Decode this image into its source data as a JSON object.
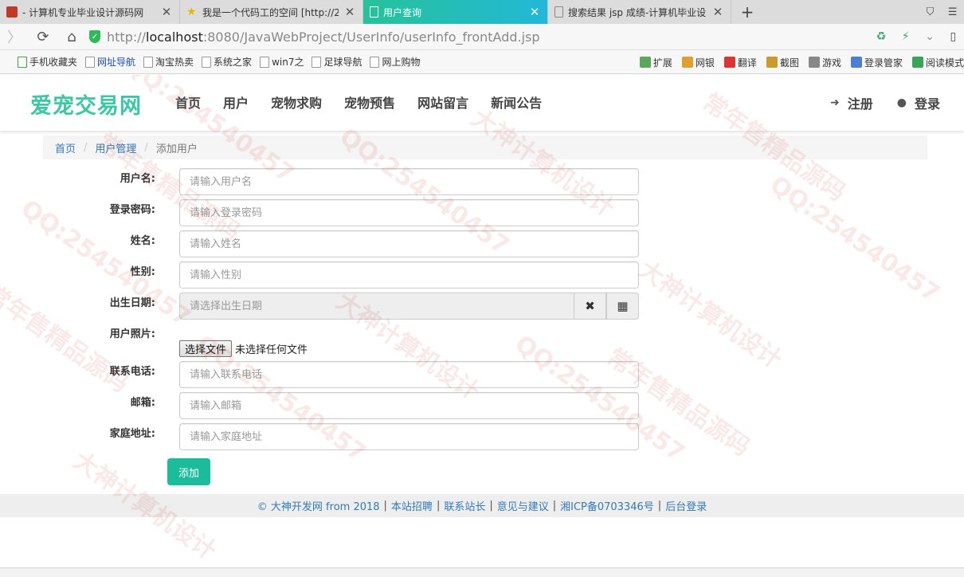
{
  "browser": {
    "tabs": [
      {
        "label": "- 计算机专业毕业设计源码网",
        "active": false
      },
      {
        "label": "我是一个代码工的空间 [http://2",
        "active": false
      },
      {
        "label": "用户查询",
        "active": true
      },
      {
        "label": "搜索结果 jsp 成绩-计算机毕业设",
        "active": false
      }
    ],
    "new_tab": "+",
    "url_prefix": "http://",
    "url_host": "localhost",
    "url_rest": ":8080/JavaWebProject/UserInfo/userInfo_frontAdd.jsp",
    "bookmarks": [
      "手机收藏夹",
      "网址导航",
      "淘宝热卖",
      "系统之家",
      "win7之",
      "足球导航",
      "网上购物"
    ],
    "toolbar_right": [
      "扩展",
      "网银",
      "翻译",
      "截图",
      "游戏",
      "登录管家",
      "阅读模式"
    ]
  },
  "site": {
    "logo": "爱宠交易网",
    "nav": [
      "首页",
      "用户",
      "宠物求购",
      "宠物预售",
      "网站留言",
      "新闻公告"
    ],
    "register": "注册",
    "login": "登录"
  },
  "breadcrumb": {
    "home": "首页",
    "section": "用户管理",
    "current": "添加用户",
    "separator": "/"
  },
  "form": {
    "username": {
      "label": "用户名:",
      "placeholder": "请输入用户名"
    },
    "password": {
      "label": "登录密码:",
      "placeholder": "请输入登录密码"
    },
    "name": {
      "label": "姓名:",
      "placeholder": "请输入姓名"
    },
    "gender": {
      "label": "性别:",
      "placeholder": "请输入性别"
    },
    "birthday": {
      "label": "出生日期:",
      "placeholder": "请选择出生日期"
    },
    "photo": {
      "label": "用户照片:",
      "button": "选择文件",
      "status": "未选择任何文件"
    },
    "phone": {
      "label": "联系电话:",
      "placeholder": "请输入联系电话"
    },
    "email": {
      "label": "邮箱:",
      "placeholder": "请输入邮箱"
    },
    "address": {
      "label": "家庭地址:",
      "placeholder": "请输入家庭地址"
    },
    "submit": "添加"
  },
  "footer": {
    "links": [
      "© 大神开发网 from 2018",
      "本站招聘",
      "联系站长",
      "意见与建议",
      "湘ICP备0703346号",
      "后台登录"
    ],
    "separator": "|"
  },
  "watermark": {
    "texts": [
      "QQ:254540457",
      "大神计算机设计",
      "常年售精品源码"
    ]
  },
  "colors": {
    "brand": "#3cc8a4",
    "primary_button": "#1abc9c",
    "link": "#337ab7",
    "active_tab_start": "#27c29a",
    "active_tab_end": "#22b8d8"
  }
}
